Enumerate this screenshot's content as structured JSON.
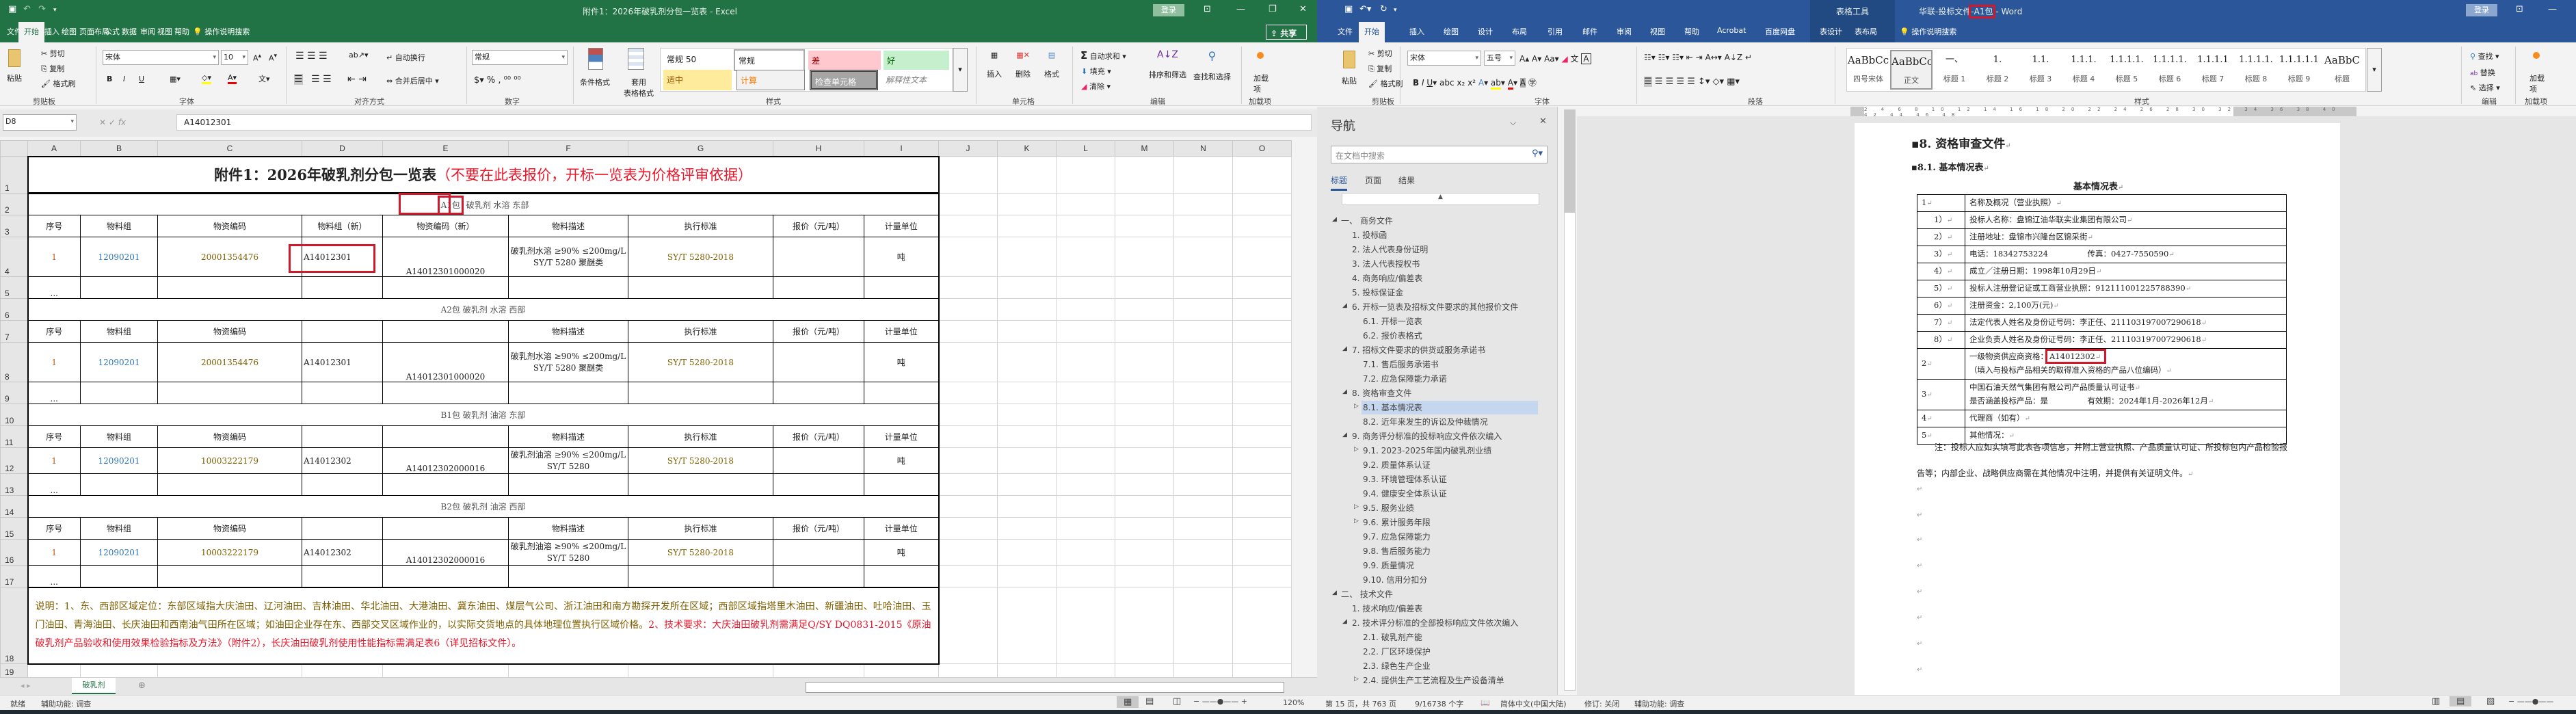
{
  "excel": {
    "title": "附件1：2026年破乳剂分包一览表 - Excel",
    "login": "登录",
    "share": "共享",
    "tabs": [
      "文件",
      "开始",
      "插入",
      "绘图",
      "页面布局",
      "公式",
      "数据",
      "审阅",
      "视图",
      "帮助"
    ],
    "tell_me": "操作说明搜索",
    "ribbon": {
      "clipboard": {
        "paste": "粘贴",
        "cut": "剪切",
        "copy": "复制",
        "format_painter": "格式刷",
        "label": "剪贴板"
      },
      "font": {
        "name": "宋体",
        "size": "10",
        "label": "字体",
        "bold": "B",
        "italic": "I",
        "underline": "U"
      },
      "alignment": {
        "wrap": "自动换行",
        "merge": "合并后居中",
        "label": "对齐方式"
      },
      "number": {
        "format": "常规",
        "label": "数字"
      },
      "styles": {
        "conditional": "条件格式",
        "table": "套用",
        "table2": "表格格式",
        "gallery": [
          "常规 50",
          "常规",
          "差",
          "好",
          "适中",
          "计算",
          "检查单元格",
          "解释性文本"
        ],
        "label": "样式"
      },
      "cells": {
        "insert": "插入",
        "delete": "删除",
        "format": "格式",
        "label": "单元格"
      },
      "editing": {
        "autosum": "自动求和",
        "fill": "填充",
        "clear": "清除",
        "sort": "排序和筛选",
        "find": "查找和选择",
        "label": "编辑"
      },
      "addins": {
        "button": "加载项",
        "label": "加载项"
      }
    },
    "name_box": "D8",
    "formula": "A14012301",
    "columns": [
      "A",
      "B",
      "C",
      "D",
      "E",
      "F",
      "G",
      "H",
      "I",
      "J",
      "K",
      "L",
      "M",
      "N",
      "O"
    ],
    "sheet": {
      "title": "附件1：2026年破乳剂分包一览表",
      "title_note": "（不要在此表报价，开标一览表为价格评审依据）",
      "packages": [
        {
          "code": "A1包",
          "name": " 破乳剂 水溶 东部",
          "headers": [
            "序号",
            "物料组",
            "物资编码",
            "物料组（新）",
            "物资编码（新）",
            "物料描述",
            "执行标准",
            "报价（元/吨）",
            "计量单位"
          ],
          "row": [
            "1",
            "12090201",
            "20001354476",
            "A14012301",
            "A14012301000020",
            "破乳剂水溶 ≥90% ≤200mg/L SY/T 5280 聚醚类",
            "SY/T 5280-2018",
            "",
            "吨"
          ]
        },
        {
          "code": "A2包",
          "name": " 破乳剂 水溶 西部",
          "headers": [
            "序号",
            "物料组",
            "物资编码",
            "",
            "",
            "物料描述",
            "执行标准",
            "报价（元/吨）",
            "计量单位"
          ],
          "row": [
            "1",
            "12090201",
            "20001354476",
            "A14012301",
            "A14012301000020",
            "破乳剂水溶 ≥90% ≤200mg/L SY/T 5280 聚醚类",
            "SY/T 5280-2018",
            "",
            "吨"
          ]
        },
        {
          "code": "B1包",
          "name": " 破乳剂 油溶 东部",
          "headers": [
            "序号",
            "物料组",
            "物资编码",
            "",
            "",
            "物料描述",
            "执行标准",
            "报价（元/吨）",
            "计量单位"
          ],
          "row": [
            "1",
            "12090201",
            "10003222179",
            "A14012302",
            "A14012302000016",
            "破乳剂油溶 ≥90% ≤200mg/L SY/T 5280",
            "SY/T 5280-2018",
            "",
            "吨"
          ]
        },
        {
          "code": "B2包",
          "name": " 破乳剂 油溶 西部",
          "headers": [
            "序号",
            "物料组",
            "物资编码",
            "",
            "",
            "物料描述",
            "执行标准",
            "报价（元/吨）",
            "计量单位"
          ],
          "row": [
            "1",
            "12090201",
            "10003222179",
            "A14012302",
            "A14012302000016",
            "破乳剂油溶 ≥90% ≤200mg/L SY/T 5280",
            "SY/T 5280-2018",
            "",
            "吨"
          ]
        }
      ],
      "ellipsis": "...",
      "note_black": "说明：1、东、西部区域定位：东部区域指大庆油田、辽河油田、吉林油田、华北油田、大港油田、冀东油田、煤层气公司、浙江油田和南方勘探开发所在区域；西部区域指塔里木油田、新疆油田、吐哈油田、玉门油田、青海油田、长庆油田和西南油气田所在区域；如油田企业存在东、西部交叉区域作业的，以实际交货地点的具体地理位置执行区域价格。",
      "note_red": "2、技术要求：大庆油田破乳剂需满足Q/SY DQ0831-2015《原油破乳剂产品验收和使用效果检验指标及方法》（附件2），长庆油田破乳剂使用性能指标需满足表6（详见招标文件）。"
    },
    "sheet_tab": "破乳剂",
    "status": {
      "ready": "就绪",
      "accessibility": "辅助功能: 调查",
      "zoom": "120%"
    }
  },
  "word": {
    "title_prefix": "华联-投标文件",
    "title_highlight": "-A1包",
    "title_suffix": " - Word",
    "context_tab": "表格工具",
    "login": "登录",
    "tabs": [
      "文件",
      "开始",
      "插入",
      "绘图",
      "设计",
      "布局",
      "引用",
      "邮件",
      "审阅",
      "视图",
      "帮助",
      "Acrobat",
      "百度网盘",
      "表设计",
      "表布局"
    ],
    "tell_me": "操作说明搜索",
    "ribbon": {
      "clipboard": {
        "paste": "粘贴",
        "cut": "剪切",
        "copy": "复制",
        "format_painter": "格式刷",
        "label": "剪贴板"
      },
      "font": {
        "name": "宋体",
        "size": "五号",
        "label": "字体"
      },
      "paragraph": {
        "label": "段落"
      },
      "styles": {
        "items": [
          {
            "preview": "AaBbCc",
            "label": "四号宋体"
          },
          {
            "preview": "AaBbCcDdI",
            "label": "正文"
          },
          {
            "preview": "一、",
            "label": "标题 1"
          },
          {
            "preview": "1.",
            "label": "标题 2"
          },
          {
            "preview": "1.1.",
            "label": "标题 3"
          },
          {
            "preview": "1.1.1.",
            "label": "标题 4"
          },
          {
            "preview": "1.1.1.1.",
            "label": "标题 5"
          },
          {
            "preview": "1.1.1.1.",
            "label": "标题 6"
          },
          {
            "preview": "1.1.1.1",
            "label": "标题 7"
          },
          {
            "preview": "1.1.1.1.",
            "label": "标题 8"
          },
          {
            "preview": "1.1.1.1.1",
            "label": "标题 9"
          },
          {
            "preview": "AaBbC",
            "label": "标题"
          }
        ],
        "label": "样式"
      },
      "editing": {
        "find": "查找",
        "replace": "替换",
        "select": "选择",
        "label": "编辑"
      },
      "addins": {
        "button": "加载项",
        "label": "加载项"
      }
    },
    "nav": {
      "title": "导航",
      "search_placeholder": "在文档中搜索",
      "tabs": [
        "标题",
        "页面",
        "结果"
      ],
      "items": [
        {
          "label": "一、 商务文件",
          "level": 0,
          "state": "open"
        },
        {
          "label": "1. 投标函",
          "level": 1
        },
        {
          "label": "2. 法人代表身份证明",
          "level": 1
        },
        {
          "label": "3. 法人代表授权书",
          "level": 1
        },
        {
          "label": "4. 商务响应/偏差表",
          "level": 1
        },
        {
          "label": "5. 投标保证金",
          "level": 1
        },
        {
          "label": "6. 开标一览表及招标文件要求的其他报价文件",
          "level": 1,
          "state": "open"
        },
        {
          "label": "6.1. 开标一览表",
          "level": 2
        },
        {
          "label": "6.2. 报价表格式",
          "level": 2
        },
        {
          "label": "7. 招标文件要求的供货或服务承诺书",
          "level": 1,
          "state": "open"
        },
        {
          "label": "7.1. 售后服务承诺书",
          "level": 2
        },
        {
          "label": "7.2. 应急保障能力承诺",
          "level": 2
        },
        {
          "label": "8. 资格审查文件",
          "level": 1,
          "state": "open"
        },
        {
          "label": "8.1. 基本情况表",
          "level": 2,
          "state": "closed",
          "selected": true
        },
        {
          "label": "8.2. 近年来发生的诉讼及仲裁情况",
          "level": 2
        },
        {
          "label": "9. 商务评分标准的投标响应文件依次编入",
          "level": 1,
          "state": "open"
        },
        {
          "label": "9.1. 2023-2025年国内破乳剂业绩",
          "level": 2,
          "state": "closed"
        },
        {
          "label": "9.2. 质量体系认证",
          "level": 2
        },
        {
          "label": "9.3. 环境管理体系认证",
          "level": 2
        },
        {
          "label": "9.4. 健康安全体系认证",
          "level": 2
        },
        {
          "label": "9.5. 服务业绩",
          "level": 2,
          "state": "closed"
        },
        {
          "label": "9.6. 累计服务年限",
          "level": 2,
          "state": "closed"
        },
        {
          "label": "9.7. 应急保障能力",
          "level": 2
        },
        {
          "label": "9.8. 售后服务能力",
          "level": 2
        },
        {
          "label": "9.9. 质量情况",
          "level": 2
        },
        {
          "label": "9.10. 信用分扣分",
          "level": 2
        },
        {
          "label": "二、 技术文件",
          "level": 0,
          "state": "open"
        },
        {
          "label": "1. 技术响应/偏差表",
          "level": 1
        },
        {
          "label": "2. 技术评分标准的全部投标响应文件依次编入",
          "level": 1,
          "state": "open"
        },
        {
          "label": "2.1. 破乳剂产能",
          "level": 2
        },
        {
          "label": "2.2. 厂区环境保护",
          "level": 2
        },
        {
          "label": "2.3. 绿色生产企业",
          "level": 2
        },
        {
          "label": "2.4. 提供生产工艺流程及生产设备清单",
          "level": 2,
          "state": "closed"
        }
      ]
    },
    "doc": {
      "heading1": "8. 资格审查文件",
      "heading2": "8.1. 基本情况表",
      "table_title": "基本情况表",
      "rows": [
        {
          "no": "1",
          "lines": [
            "名称及概况（营业执照）"
          ]
        },
        {
          "no": "1）",
          "lines": [
            "投标人名称：盘锦辽油华联实业集团有限公司"
          ]
        },
        {
          "no": "2）",
          "lines": [
            "注册地址：盘锦市兴隆台区锦采街"
          ]
        },
        {
          "no": "3）",
          "lines": [
            "电话：18342753224　　　　　传真：0427-7550590"
          ]
        },
        {
          "no": "4）",
          "lines": [
            "成立／注册日期：1998年10月29日"
          ]
        },
        {
          "no": "5）",
          "lines": [
            "投标人注册登记证或工商营业执照：912111001225788390"
          ]
        },
        {
          "no": "6）",
          "lines": [
            "注册资金：2,100万(元)"
          ]
        },
        {
          "no": "7）",
          "lines": [
            "法定代表人姓名及身份证号码：李正任、211103197007290618"
          ]
        },
        {
          "no": "8）",
          "lines": [
            "企业负责人姓名及身份证号码：李正任、211103197007290618"
          ]
        },
        {
          "no": "2",
          "label": "一级物资供应商资格：",
          "value": "A14012302",
          "lines": [
            "（填入与投标产品相关的取得准入资格的产品八位编码）"
          ]
        },
        {
          "no": "3",
          "lines": [
            "中国石油天然气集团有限公司产品质量认可证书",
            "是否涵盖投标产品：是　　　　　有效期：2024年1月-2026年12月"
          ]
        },
        {
          "no": "4",
          "lines": [
            "代理商（如有）"
          ]
        },
        {
          "no": "5",
          "lines": [
            "其他情况："
          ]
        }
      ],
      "note": "注：投标人应如实填写此表各项信息，并附上营业执照、产品质量认可证、所投标包内产品检验报告等；内部企业、战略供应商需在其他情况中注明，并提供有关证明文件。"
    },
    "status": {
      "page": "第 15 页，共 763 页",
      "words": "9/16738 个字",
      "language": "简体中文(中国大陆)",
      "track": "修订: 关闭",
      "accessibility": "辅助功能: 调查"
    }
  },
  "colors": {
    "excel_green": "#217346",
    "word_blue": "#2b579a",
    "highlight_red": "#d0192a",
    "note_red": "#e8192c"
  }
}
